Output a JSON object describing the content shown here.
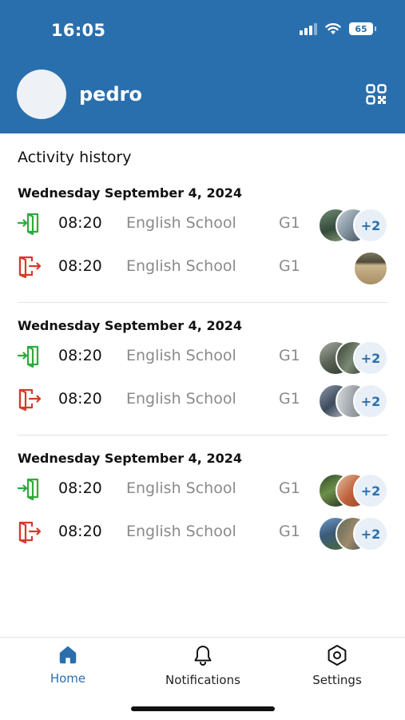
{
  "status_bar": {
    "time": "16:05",
    "battery": "65"
  },
  "profile": {
    "name": "pedro"
  },
  "section_title": "Activity history",
  "groups": [
    {
      "date": "Wednesday September 4, 2024",
      "rows": [
        {
          "direction": "in",
          "time": "08:20",
          "place": "English School",
          "grade": "G1",
          "more": "+2"
        },
        {
          "direction": "out",
          "time": "08:20",
          "place": "English School",
          "grade": "G1",
          "more": ""
        }
      ]
    },
    {
      "date": "Wednesday September 4, 2024",
      "rows": [
        {
          "direction": "in",
          "time": "08:20",
          "place": "English School",
          "grade": "G1",
          "more": "+2"
        },
        {
          "direction": "out",
          "time": "08:20",
          "place": "English School",
          "grade": "G1",
          "more": "+2"
        }
      ]
    },
    {
      "date": "Wednesday September 4, 2024",
      "rows": [
        {
          "direction": "in",
          "time": "08:20",
          "place": "English School",
          "grade": "G1",
          "more": "+2"
        },
        {
          "direction": "out",
          "time": "08:20",
          "place": "English School",
          "grade": "G1",
          "more": "+2"
        }
      ]
    }
  ],
  "tabs": [
    {
      "label": "Home",
      "icon": "home-icon",
      "active": true
    },
    {
      "label": "Notifications",
      "icon": "bell-icon",
      "active": false
    },
    {
      "label": "Settings",
      "icon": "settings-icon",
      "active": false
    }
  ],
  "colors": {
    "brand": "#2a6fad",
    "entry": "#2eaa3c",
    "exit": "#d63a2a",
    "muted": "#8a8a8a"
  }
}
